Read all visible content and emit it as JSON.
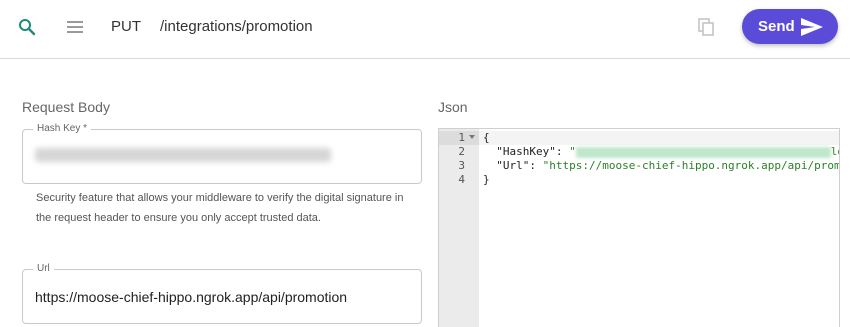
{
  "topbar": {
    "method": "PUT",
    "path": "/integrations/promotion",
    "send_label": "Send",
    "accent_color": "#5a4bd8",
    "icons": [
      "search-icon",
      "menu-icon",
      "copy-icon",
      "send-icon"
    ]
  },
  "request_body": {
    "title": "Request Body",
    "hash_key": {
      "label": "Hash Key *",
      "value_masked": true
    },
    "helper_text": "Security feature that allows your middleware to verify the digital signature in the request header to ensure you only accept trusted data.",
    "url": {
      "label": "Url",
      "value": "https://moose-chief-hippo.ngrok.app/api/promotion"
    }
  },
  "json_panel": {
    "title": "Json",
    "line_numbers": [
      "1",
      "2",
      "3",
      "4"
    ],
    "lines": {
      "open": "{",
      "hash_key_name": "\"HashKey\"",
      "hash_key_suffix": "lo",
      "url_key": "\"Url\"",
      "url_value": "\"https://moose-chief-hippo.ngrok.app/api/prom",
      "close": "}"
    }
  }
}
